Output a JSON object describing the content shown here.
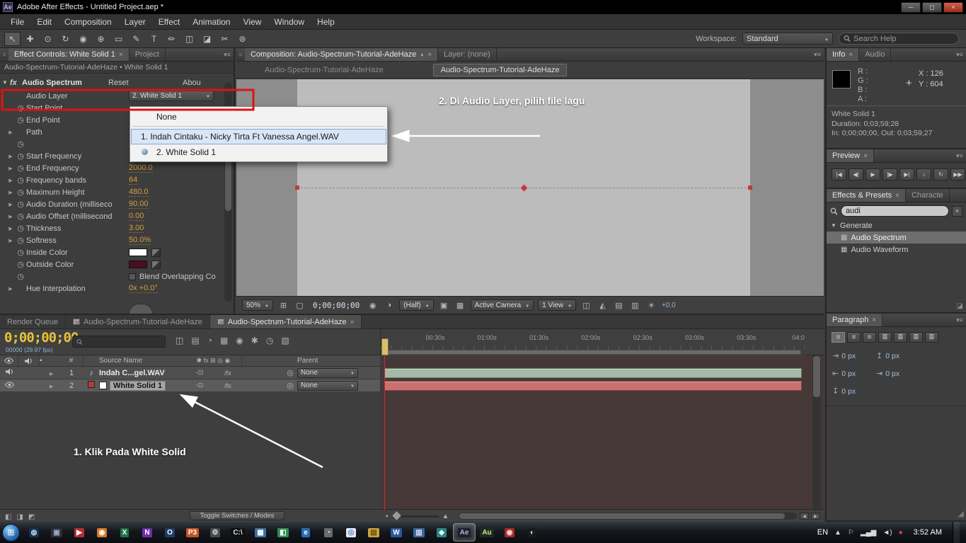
{
  "titlebar": {
    "icon": "Ae",
    "title": "Adobe After Effects - Untitled Project.aep *",
    "buttons": [
      {
        "name": "minimize-button",
        "glyph": "─"
      },
      {
        "name": "maximize-button",
        "glyph": "◻"
      },
      {
        "name": "close-button",
        "glyph": "×"
      }
    ]
  },
  "menubar": {
    "items": [
      "File",
      "Edit",
      "Composition",
      "Layer",
      "Effect",
      "Animation",
      "View",
      "Window",
      "Help"
    ]
  },
  "toolbar": {
    "tools": [
      {
        "name": "selection-tool",
        "glyph": "↖"
      },
      {
        "name": "hand-tool",
        "glyph": "✚"
      },
      {
        "name": "zoom-tool",
        "glyph": "⊙"
      },
      {
        "name": "rotation-tool",
        "glyph": "↻"
      },
      {
        "name": "camera-tool",
        "glyph": "◉"
      },
      {
        "name": "pan-behind-tool",
        "glyph": "⊕"
      },
      {
        "name": "mask-shape-tool",
        "glyph": "▭"
      },
      {
        "name": "pen-tool",
        "glyph": "✎"
      },
      {
        "name": "type-tool",
        "glyph": "T"
      },
      {
        "name": "brush-tool",
        "glyph": "✏"
      },
      {
        "name": "clone-stamp-tool",
        "glyph": "◫"
      },
      {
        "name": "eraser-tool",
        "glyph": "◪"
      },
      {
        "name": "roto-brush-tool",
        "glyph": "✂"
      },
      {
        "name": "puppet-pin-tool",
        "glyph": "⊚"
      }
    ],
    "workspace_label": "Workspace:",
    "workspace_value": "Standard",
    "search_placeholder": "Search Help"
  },
  "effect_controls": {
    "tab": "Effect Controls: White Solid 1",
    "tab_project": "Project",
    "breadcrumb": "Audio-Spectrum-Tutorial-AdeHaze • White Solid 1",
    "fx_label": "fx",
    "effect_name": "Audio Spectrum",
    "reset_label": "Reset",
    "about_label": "Abou",
    "rows": [
      {
        "name": "audio-layer",
        "label": "Audio Layer",
        "control": "dropdown",
        "value": "2. White Solid 1"
      },
      {
        "name": "start-point",
        "label": "Start Point",
        "stopwatch": true
      },
      {
        "name": "end-point",
        "label": "End Point",
        "stopwatch": true
      },
      {
        "name": "path",
        "label": "Path",
        "arrow": true
      },
      {
        "name": "path-stopwatch",
        "label": "",
        "stopwatch": true
      },
      {
        "name": "start-frequency",
        "label": "Start Frequency",
        "arrow": true,
        "stopwatch": true
      },
      {
        "name": "end-frequency",
        "label": "End Frequency",
        "arrow": true,
        "stopwatch": true,
        "value": "2000.0"
      },
      {
        "name": "frequency-bands",
        "label": "Frequency bands",
        "arrow": true,
        "stopwatch": true,
        "value": "64"
      },
      {
        "name": "maximum-height",
        "label": "Maximum Height",
        "arrow": true,
        "stopwatch": true,
        "value": "480.0"
      },
      {
        "name": "audio-duration",
        "label": "Audio Duration (milliseco",
        "arrow": true,
        "stopwatch": true,
        "value": "90.00"
      },
      {
        "name": "audio-offset",
        "label": "Audio Offset (millisecond",
        "arrow": true,
        "stopwatch": true,
        "value": "0.00"
      },
      {
        "name": "thickness",
        "label": "Thickness",
        "arrow": true,
        "stopwatch": true,
        "value": "3.00"
      },
      {
        "name": "softness",
        "label": "Softness",
        "arrow": true,
        "stopwatch": true,
        "value": "50.0%"
      },
      {
        "name": "inside-color",
        "label": "Inside Color",
        "stopwatch": true,
        "swatch": "#ffffff"
      },
      {
        "name": "outside-color",
        "label": "Outside Color",
        "stopwatch": true,
        "swatch": "#4a0e22"
      },
      {
        "name": "blend-overlapping",
        "label": "Blend Overlapping Co",
        "stopwatch": true,
        "checkbox": true
      },
      {
        "name": "hue-interpolation",
        "label": "Hue Interpolation",
        "arrow": true,
        "value": "0x +0.0°"
      }
    ]
  },
  "audio_layer_menu": {
    "items": [
      {
        "label": "None",
        "kind": "plain"
      },
      {
        "label": "1. Indah Cintaku - Nicky Tirta Ft Vanessa Angel.WAV",
        "kind": "file",
        "highlighted": true
      },
      {
        "label": "2. White Solid 1",
        "kind": "plain",
        "selected": true
      }
    ]
  },
  "comp_panel": {
    "tab": "Composition: Audio-Spectrum-Tutorial-AdeHaze",
    "tab_layer": "Layer: (none)",
    "viewer_tabs": [
      {
        "label": "Audio-Spectrum-Tutorial-AdeHaze",
        "active": false
      },
      {
        "label": "Audio-Spectrum-Tutorial-AdeHaze",
        "active": true
      }
    ],
    "toolbar": [
      {
        "kind": "dropdown",
        "name": "magnification-select",
        "label": "50%"
      },
      {
        "kind": "icon",
        "name": "safe-margins-icon",
        "glyph": "⊞"
      },
      {
        "kind": "icon",
        "name": "mask-visibility-icon",
        "glyph": "▢"
      },
      {
        "kind": "timecode",
        "name": "current-time-display",
        "label": "0;00;00;00"
      },
      {
        "kind": "icon",
        "name": "snapshot-icon",
        "glyph": "◉"
      },
      {
        "kind": "icon",
        "name": "show-channel-icon",
        "glyph": "◑"
      },
      {
        "kind": "dropdown",
        "name": "resolution-select",
        "label": "(Half)"
      },
      {
        "kind": "icon",
        "name": "region-of-interest-icon",
        "glyph": "▣"
      },
      {
        "kind": "icon",
        "name": "transparency-grid-icon",
        "glyph": "▦"
      },
      {
        "kind": "dropdown",
        "name": "camera-select",
        "label": "Active Camera"
      },
      {
        "kind": "dropdown",
        "name": "view-layout-select",
        "label": "1 View"
      },
      {
        "kind": "icon",
        "name": "pixel-aspect-correction-icon",
        "glyph": "◫"
      },
      {
        "kind": "icon",
        "name": "fast-previews-icon",
        "glyph": "◭"
      },
      {
        "kind": "icon",
        "name": "timeline-button-icon",
        "glyph": "▤"
      },
      {
        "kind": "icon",
        "name": "flowchart-button-icon",
        "glyph": "▥"
      },
      {
        "kind": "icon",
        "name": "exposure-icon",
        "glyph": "☀"
      },
      {
        "kind": "text",
        "name": "exposure-value",
        "label": "+0.0"
      }
    ]
  },
  "info_panel": {
    "tab": "Info",
    "tab_audio": "Audio",
    "channel_labels": "R :\nG :\nB :\nA :",
    "crosshair": "+",
    "x_value": "X : 126",
    "y_value": "Y : 604",
    "solid_name": "White Solid 1",
    "duration": "Duration: 0;03;59;28",
    "in_out": "In: 0;00;00;00, Out: 0;03;59;27"
  },
  "preview_panel": {
    "tab": "Preview",
    "buttons": [
      {
        "name": "first-frame-button",
        "glyph": "|◀"
      },
      {
        "name": "previous-frame-button",
        "glyph": "◀|"
      },
      {
        "name": "play-button",
        "glyph": "▶"
      },
      {
        "name": "next-frame-button",
        "glyph": "|▶"
      },
      {
        "name": "last-frame-button",
        "glyph": "▶|"
      },
      {
        "name": "audio-toggle-button",
        "glyph": "♪"
      },
      {
        "name": "loop-button",
        "glyph": "↻"
      },
      {
        "name": "ram-preview-button",
        "glyph": "▶▶"
      }
    ]
  },
  "effects_presets": {
    "tab": "Effects & Presets",
    "tab_character": "Characte",
    "search_value": "audi",
    "items": [
      {
        "label": "Generate",
        "type": "folder"
      },
      {
        "label": "Audio Spectrum",
        "type": "effect",
        "selected": true
      },
      {
        "label": "Audio Waveform",
        "type": "effect",
        "selected": false
      }
    ]
  },
  "paragraph_panel": {
    "tab": "Paragraph",
    "align_buttons": [
      {
        "name": "align-left-button",
        "glyph": "≡",
        "active": true
      },
      {
        "name": "align-center-button",
        "glyph": "≡",
        "active": false
      },
      {
        "name": "align-right-button",
        "glyph": "≡",
        "active": false
      },
      {
        "name": "justify-last-left-button",
        "glyph": "≣",
        "active": false
      },
      {
        "name": "justify-last-center-button",
        "glyph": "≣",
        "active": false
      },
      {
        "name": "justify-last-right-button",
        "glyph": "≣",
        "active": false
      },
      {
        "name": "justify-all-button",
        "glyph": "≣",
        "active": false
      }
    ],
    "fields": [
      {
        "name": "indent-left-field",
        "icon": "⇥",
        "value": "0 px"
      },
      {
        "name": "space-before-field",
        "icon": "↥",
        "value": "0 px"
      },
      {
        "name": "indent-right-field",
        "icon": "⇤",
        "value": "0 px"
      },
      {
        "name": "first-line-indent-field",
        "icon": "⇥",
        "value": "0 px"
      },
      {
        "name": "space-after-field",
        "icon": "↧",
        "value": "0 px"
      }
    ]
  },
  "timeline": {
    "tabs": [
      {
        "label": "Render Queue",
        "icon": false,
        "active": false,
        "close": false
      },
      {
        "label": "Audio-Spectrum-Tutorial-AdeHaze",
        "icon": true,
        "active": false,
        "close": false
      },
      {
        "label": "Audio-Spectrum-Tutorial-AdeHaze",
        "icon": true,
        "active": true,
        "close": true
      }
    ],
    "timecode": "0;00;00;00",
    "frame_info": "00000 (29.97 fps)",
    "header_icons": [
      {
        "name": "comp-mini-flowchart-icon",
        "glyph": "◫"
      },
      {
        "name": "draft-3d-icon",
        "glyph": "▤"
      },
      {
        "name": "hide-shy-layers-icon",
        "glyph": "◔"
      },
      {
        "name": "frame-blending-icon",
        "glyph": "▦"
      },
      {
        "name": "motion-blur-icon",
        "glyph": "◉"
      },
      {
        "name": "brainstorm-icon",
        "glyph": "✱"
      },
      {
        "name": "auto-keyframe-icon",
        "glyph": "◷"
      },
      {
        "name": "graph-editor-icon",
        "glyph": "▧"
      }
    ],
    "columns": {
      "hash": "#",
      "source": "Source Name",
      "switches": "✱ fx ⊞ ◎ ◉",
      "parent": "Parent"
    },
    "switch_labels": {
      "collapse": "-⊡",
      "fx": "/fx"
    },
    "layers": [
      {
        "num": "1",
        "name": "Indah C...gel.WAV",
        "av": "audio",
        "icon": "♪",
        "parent_value": "None",
        "bar_color": "#a6b9a8",
        "bar_border": "#64805f",
        "selected": false
      },
      {
        "num": "2",
        "name": "White Solid 1",
        "av": "video",
        "chip": "#b23c3c",
        "swatch": "#ffffff",
        "parent_value": "None",
        "bar_color": "#c97070",
        "bar_border": "#8f4040",
        "selected": true
      }
    ],
    "ruler_labels": [
      "00:30s",
      "01:00s",
      "01:30s",
      "02:00s",
      "02:30s",
      "03:00s",
      "03:30s",
      "04:0"
    ],
    "bottom_icons": [
      {
        "name": "expand-layer-switches-icon",
        "glyph": "◧"
      },
      {
        "name": "expand-transfer-controls-icon",
        "glyph": "◨"
      },
      {
        "name": "expand-inout-pane-icon",
        "glyph": "◩"
      }
    ],
    "toggle_button": "Toggle Switches / Modes"
  },
  "annotations": {
    "step2": "2. Di Audio Layer, pilih file lagu",
    "step1": "1. Klik Pada White Solid",
    "highlight_color": "#e01313",
    "arrow_color": "#ffffff"
  },
  "taskbar": {
    "start_glyph": "⊞",
    "icons": [
      {
        "name": "taskbar-app-browser",
        "bg": "#14324f",
        "fg": "#bcd6ee",
        "glyph": "◍",
        "active": false
      },
      {
        "name": "taskbar-app-tool",
        "bg": "#2f2f2f",
        "fg": "#99aadd",
        "glyph": "▣",
        "active": false
      },
      {
        "name": "taskbar-app-media",
        "bg": "#b03030",
        "fg": "#ffffff",
        "glyph": "▶",
        "active": false
      },
      {
        "name": "taskbar-app-firefox",
        "bg": "#d97a26",
        "fg": "#ffffff",
        "glyph": "◉",
        "active": false
      },
      {
        "name": "taskbar-app-excel",
        "bg": "#1f7246",
        "fg": "#ffffff",
        "glyph": "X",
        "active": false
      },
      {
        "name": "taskbar-app-onenote",
        "bg": "#6f2da8",
        "fg": "#ffffff",
        "glyph": "N",
        "active": false
      },
      {
        "name": "taskbar-app-outlook",
        "bg": "#1d3e6b",
        "fg": "#ffffff",
        "glyph": "O",
        "active": false
      },
      {
        "name": "taskbar-app-p3",
        "bg": "#c4541f",
        "fg": "#ffffff",
        "glyph": "P3",
        "active": false
      },
      {
        "name": "taskbar-app-utility",
        "bg": "#4a4a4a",
        "fg": "#dddddd",
        "glyph": "⚙",
        "active": false
      },
      {
        "name": "taskbar-app-cmd",
        "bg": "#101010",
        "fg": "#dddddd",
        "glyph": "C:\\",
        "active": false
      },
      {
        "name": "taskbar-app-photos",
        "bg": "#3f6fa8",
        "fg": "#ffffff",
        "glyph": "▦",
        "active": false
      },
      {
        "name": "taskbar-app-notes",
        "bg": "#2f8f4f",
        "fg": "#ffffff",
        "glyph": "◧",
        "active": false
      },
      {
        "name": "taskbar-app-ie",
        "bg": "#2a6db5",
        "fg": "#ffffff",
        "glyph": "e",
        "active": false
      },
      {
        "name": "taskbar-app-clock",
        "bg": "#6a6a6a",
        "fg": "#eeeeee",
        "glyph": "◔",
        "active": false
      },
      {
        "name": "taskbar-app-chrome",
        "bg": "#e8e8e8",
        "fg": "#4285f4",
        "glyph": "◎",
        "active": false
      },
      {
        "name": "taskbar-app-folder",
        "bg": "#caa23a",
        "fg": "#6a4f10",
        "glyph": "▤",
        "active": false
      },
      {
        "name": "taskbar-app-word",
        "bg": "#2b579a",
        "fg": "#ffffff",
        "glyph": "W",
        "active": false
      },
      {
        "name": "taskbar-app-remote",
        "bg": "#36699c",
        "fg": "#ddddee",
        "glyph": "▥",
        "active": false
      },
      {
        "name": "taskbar-app-teal",
        "bg": "#2e8380",
        "fg": "#ddffff",
        "glyph": "◆",
        "active": false
      },
      {
        "name": "taskbar-app-after-effects",
        "bg": "#1f1f2a",
        "fg": "#b8b0d8",
        "glyph": "Ae",
        "active": true
      },
      {
        "name": "taskbar-app-audition",
        "bg": "#1f2a1f",
        "fg": "#cfe0a0",
        "glyph": "Au",
        "active": false
      },
      {
        "name": "taskbar-app-red",
        "bg": "#a82828",
        "fg": "#ffdddd",
        "glyph": "◉",
        "active": false
      },
      {
        "name": "taskbar-app-dark",
        "bg": "#1a1a1a",
        "fg": "#dddddd",
        "glyph": "◐",
        "active": false
      }
    ],
    "lang": "EN",
    "tray": [
      {
        "name": "show-hidden-icons",
        "glyph": "▲"
      },
      {
        "name": "flag-icon",
        "glyph": "⚐"
      },
      {
        "name": "network-icon",
        "glyph": "▂▄▆"
      },
      {
        "name": "volume-icon",
        "glyph": "◄)"
      },
      {
        "name": "security-icon",
        "glyph": "●"
      }
    ],
    "clock": "3:52 AM"
  }
}
